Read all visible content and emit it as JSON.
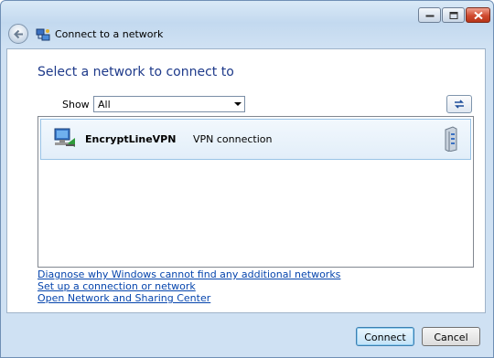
{
  "window": {
    "title": "Connect to a network",
    "icons": {
      "back": "back-arrow-icon",
      "network": "network-icon",
      "minimize": "minimize-icon",
      "maximize": "maximize-icon",
      "close": "close-icon"
    }
  },
  "main": {
    "heading": "Select a network to connect to",
    "show_label": "Show",
    "show_value": "All",
    "refresh_icon": "refresh-icon"
  },
  "networks": [
    {
      "name": "EncryptLineVPN",
      "type": "VPN connection",
      "icon": "vpn-icon",
      "signal_icon": "server-icon"
    }
  ],
  "links": [
    "Diagnose why Windows cannot find any additional networks",
    "Set up a connection or network",
    "Open Network and Sharing Center"
  ],
  "buttons": {
    "connect": "Connect",
    "cancel": "Cancel"
  }
}
